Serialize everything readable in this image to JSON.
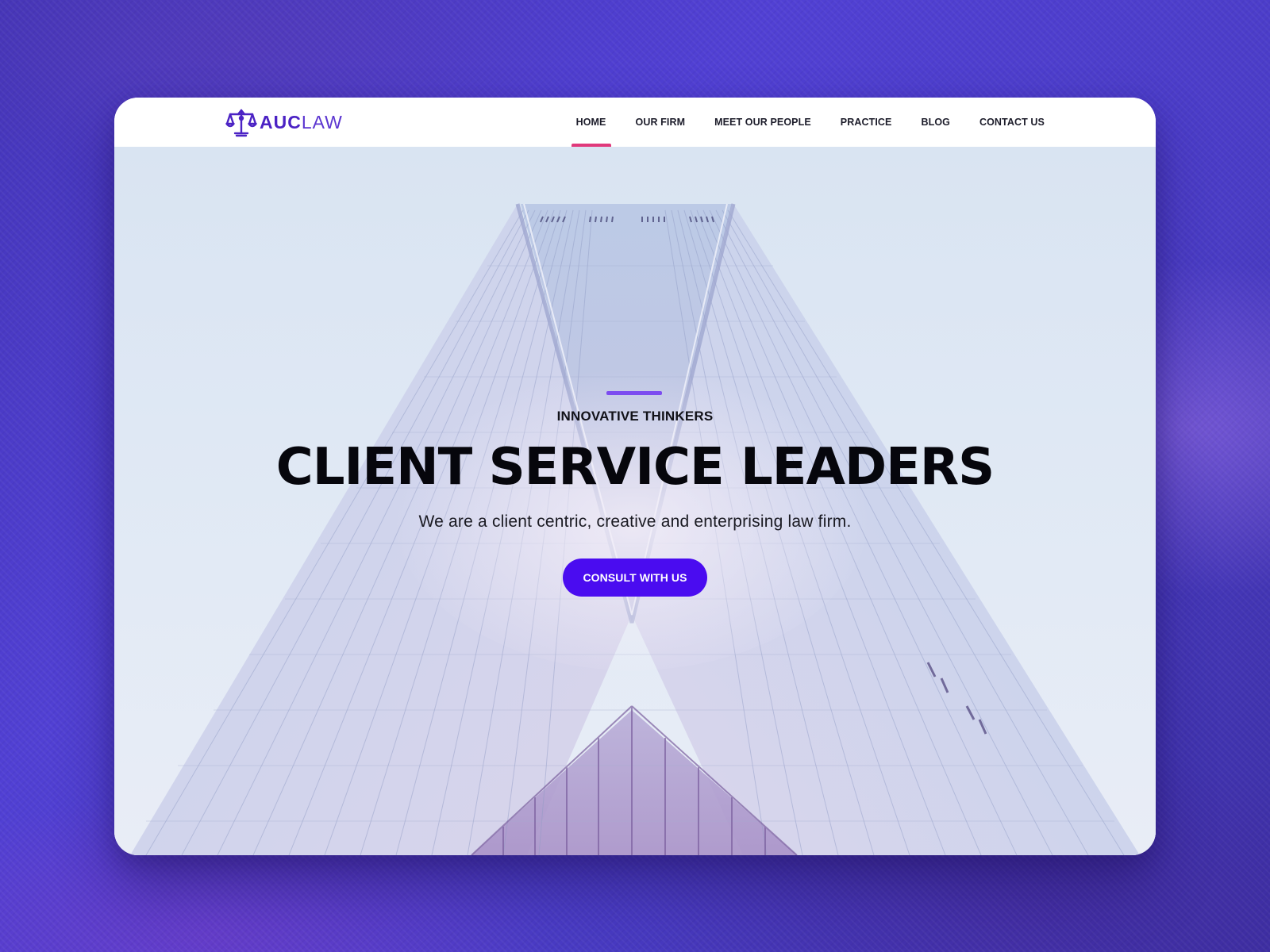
{
  "brand": {
    "name_bold": "AUC",
    "name_light": "LAW",
    "logo_icon": "scales-of-justice-icon",
    "color": "#4b22c4"
  },
  "nav": {
    "items": [
      {
        "label": "HOME",
        "active": true
      },
      {
        "label": "OUR FIRM",
        "active": false
      },
      {
        "label": "MEET OUR PEOPLE",
        "active": false
      },
      {
        "label": "PRACTICE",
        "active": false
      },
      {
        "label": "BLOG",
        "active": false
      },
      {
        "label": "CONTACT US",
        "active": false
      }
    ],
    "active_indicator_color": "#e0397b"
  },
  "hero": {
    "eyebrow": "INNOVATIVE THINKERS",
    "headline": "CLIENT SERVICE LEADERS",
    "subline": "We are a client centric, creative and enterprising law firm.",
    "cta_label": "CONSULT WITH US",
    "cta_color": "#4a0cf0",
    "accent_color": "#7c4cf0",
    "background_image": "skyscraper-photo"
  },
  "theme": {
    "page_background": "#4a36c4"
  }
}
